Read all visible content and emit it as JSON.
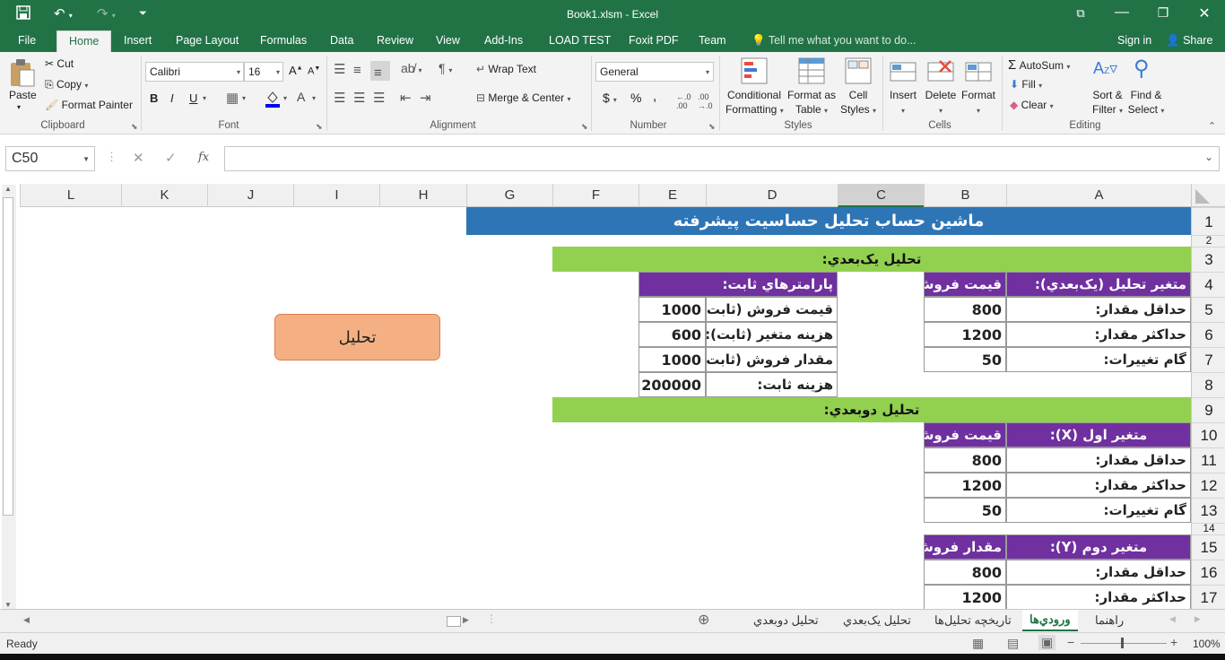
{
  "titlebar": {
    "title": "Book1.xlsm - Excel"
  },
  "tabs": [
    {
      "label": "File"
    },
    {
      "label": "Home"
    },
    {
      "label": "Insert"
    },
    {
      "label": "Page Layout"
    },
    {
      "label": "Formulas"
    },
    {
      "label": "Data"
    },
    {
      "label": "Review"
    },
    {
      "label": "View"
    },
    {
      "label": "Add-Ins"
    },
    {
      "label": "LOAD TEST"
    },
    {
      "label": "Foxit PDF"
    },
    {
      "label": "Team"
    }
  ],
  "tell_me": "Tell me what you want to do...",
  "account": {
    "signin": "Sign in",
    "share": "Share"
  },
  "clipboard": {
    "paste": "Paste",
    "cut": "Cut",
    "copy": "Copy",
    "format_painter": "Format Painter",
    "group": "Clipboard"
  },
  "font": {
    "name": "Calibri",
    "size": "16",
    "bold": "B",
    "italic": "I",
    "underline": "U",
    "group": "Font"
  },
  "alignment": {
    "wrap": "Wrap Text",
    "merge": "Merge & Center",
    "group": "Alignment"
  },
  "number": {
    "format": "General",
    "currency": "$",
    "percent": "%",
    "comma": ",",
    "group": "Number"
  },
  "styles": {
    "conditional": "Conditional",
    "conditional2": "Formatting",
    "format_as": "Format as",
    "format_as2": "Table",
    "cell": "Cell",
    "cell2": "Styles",
    "group": "Styles"
  },
  "cells": {
    "insert": "Insert",
    "delete": "Delete",
    "format": "Format",
    "group": "Cells"
  },
  "editing": {
    "autosum": "AutoSum",
    "fill": "Fill",
    "clear": "Clear",
    "sort": "Sort &",
    "sort2": "Filter",
    "find": "Find &",
    "find2": "Select",
    "group": "Editing"
  },
  "formula_bar": {
    "name_box": "C50",
    "formula": ""
  },
  "columns": [
    "L",
    "K",
    "J",
    "I",
    "H",
    "G",
    "F",
    "E",
    "D",
    "C",
    "B",
    "A"
  ],
  "rows": [
    "1",
    "2",
    "3",
    "4",
    "5",
    "6",
    "7",
    "8",
    "9",
    "10",
    "11",
    "12",
    "13",
    "14",
    "15",
    "16",
    "17"
  ],
  "sheet": {
    "title": "ماشين حساب تحليل حساسيت پيشرفته",
    "one_d_header": "تحليل يک‌بعدي:",
    "var_label": "متغير تحليل (يک‌بعدي):",
    "var_value": "قيمت فروش",
    "min_label": "حداقل مقدار:",
    "max_label": "حداکثر مقدار:",
    "step_label": "گام تغييرات:",
    "v1_min": "800",
    "v1_max": "1200",
    "v1_step": "50",
    "fixed_header": "پارامترهاي ثابت:",
    "fixed_price_label": "قيمت فروش (ثابت):",
    "fixed_price": "1000",
    "fixed_var_cost_label": "هزينه متغير (ثابت):",
    "fixed_var_cost": "600",
    "fixed_qty_label": "مقدار فروش (ثابت):",
    "fixed_qty": "1000",
    "fixed_cost_label": "هزينه ثابت:",
    "fixed_cost": "200000",
    "two_d_header": "تحليل دوبعدي:",
    "x_label": "متغير اول (X):",
    "x_value": "قيمت فروش",
    "x_min": "800",
    "x_max": "1200",
    "x_step": "50",
    "y_label": "متغير دوم (Y):",
    "y_value": "مقدار فروش",
    "y_min": "800",
    "y_max": "1200",
    "button": "تحليل"
  },
  "sheet_tabs": [
    "راهنما",
    "ورودي‌ها",
    "تاريخچه تحليل‌ها",
    "تحليل يک‌بعدي",
    "تحليل دوبعدي"
  ],
  "active_sheet": "ورودي‌ها",
  "status": {
    "ready": "Ready",
    "zoom": "100%"
  },
  "colors": {
    "excel_green": "#217346",
    "title_blue": "#2e75b6",
    "section_green": "#92d050",
    "purple": "#7030a0",
    "button_fill": "#f4b083"
  }
}
